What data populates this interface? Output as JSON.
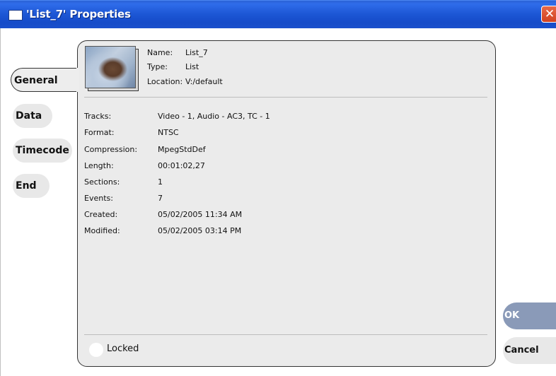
{
  "window": {
    "title": "'List_7' Properties",
    "close_glyph": "✕"
  },
  "tabs": [
    {
      "label": "General",
      "active": true
    },
    {
      "label": "Data",
      "active": false
    },
    {
      "label": "Timecode",
      "active": false
    },
    {
      "label": "End",
      "active": false
    }
  ],
  "header": {
    "name_label": "Name:",
    "name_value": "List_7",
    "type_label": "Type:",
    "type_value": "List",
    "location_label": "Location:",
    "location_value": "V:/default"
  },
  "properties": [
    {
      "label": "Tracks:",
      "value": "Video - 1, Audio - AC3, TC - 1"
    },
    {
      "label": "Format:",
      "value": "NTSC"
    },
    {
      "label": "Compression:",
      "value": "MpegStdDef"
    },
    {
      "label": "Length:",
      "value": "00:01:02,27"
    },
    {
      "label": "Sections:",
      "value": "1"
    },
    {
      "label": "Events:",
      "value": "7"
    },
    {
      "label": "Created:",
      "value": "05/02/2005 11:34 AM"
    },
    {
      "label": "Modified:",
      "value": "05/02/2005 03:14 PM"
    }
  ],
  "locked": {
    "label": "Locked",
    "checked": false
  },
  "buttons": {
    "ok": "OK",
    "cancel": "Cancel"
  },
  "colors": {
    "titlebar": "#1c56d4",
    "ok_button": "#8a9ab8",
    "panel": "#ebebeb",
    "close_button": "#d2411f"
  },
  "icons": {
    "window_icon": "window-icon",
    "close": "close-icon",
    "thumbnail": "clip-thumbnail"
  }
}
